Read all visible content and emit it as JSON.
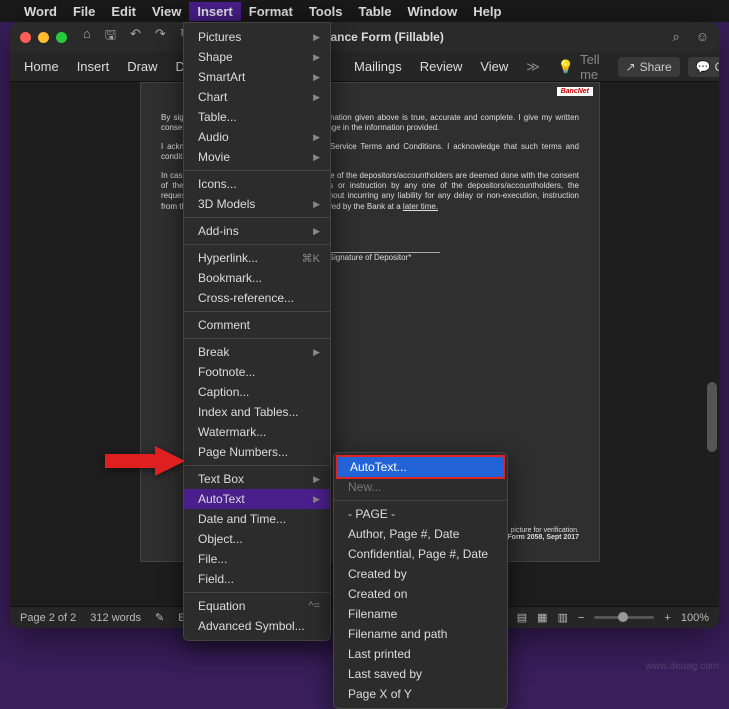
{
  "menubar": {
    "app": "Word",
    "items": [
      "File",
      "Edit",
      "View",
      "Insert",
      "Format",
      "Tools",
      "Table",
      "Window",
      "Help"
    ],
    "active_index": 3
  },
  "titlebar": {
    "title": "Maintenance Form (Fillable)"
  },
  "ribbon": {
    "tabs": [
      "Home",
      "Insert",
      "Draw",
      "Design",
      "Mailings",
      "Review",
      "View"
    ],
    "tellme": "Tell me",
    "share": "Share",
    "comments": "Comments"
  },
  "document": {
    "logo": "BancNet",
    "para1": "By signing this form, I/we certify that the information given above is true, accurate and complete. I give my written consent to and agree to inform PNB of any change in the information provided.",
    "para2": "I acknowledge receipt of the Digital Banking Service Terms and Conditions. I acknowledge that such terms and conditions apply.",
    "para3": "In case of joint accounts, instructions by any one of the depositors/accountholders are deemed done with the consent of the others. In case of conflicting requests or instruction by any one of the depositors/accountholders, the request/instruction received earlier in time, without incurring any liability for any delay or non-execution, instruction from the co-depositors/co-accountholders received by the Bank at a",
    "para3_end": "later time.",
    "sig_label": "Signature of Depositor*",
    "footer_note": "with picture for verification.",
    "footer_form": "Form 2058, Sept 2017"
  },
  "insert_menu": {
    "groups": [
      [
        {
          "label": "Pictures",
          "sub": true
        },
        {
          "label": "Shape",
          "sub": true
        },
        {
          "label": "SmartArt",
          "sub": true
        },
        {
          "label": "Chart",
          "sub": true
        },
        {
          "label": "Table...",
          "sub": false
        },
        {
          "label": "Audio",
          "sub": true
        },
        {
          "label": "Movie",
          "sub": true
        }
      ],
      [
        {
          "label": "Icons...",
          "sub": false
        },
        {
          "label": "3D Models",
          "sub": true
        }
      ],
      [
        {
          "label": "Add-ins",
          "sub": true
        }
      ],
      [
        {
          "label": "Hyperlink...",
          "sub": false,
          "shortcut": "⌘K"
        },
        {
          "label": "Bookmark...",
          "sub": false
        },
        {
          "label": "Cross-reference...",
          "sub": false
        }
      ],
      [
        {
          "label": "Comment",
          "sub": false
        }
      ],
      [
        {
          "label": "Break",
          "sub": true
        },
        {
          "label": "Footnote...",
          "sub": false
        },
        {
          "label": "Caption...",
          "sub": false
        },
        {
          "label": "Index and Tables...",
          "sub": false
        },
        {
          "label": "Watermark...",
          "sub": false
        },
        {
          "label": "Page Numbers...",
          "sub": false
        }
      ],
      [
        {
          "label": "Text Box",
          "sub": true
        },
        {
          "label": "AutoText",
          "sub": true,
          "hl": true
        },
        {
          "label": "Date and Time...",
          "sub": false
        },
        {
          "label": "Object...",
          "sub": false
        },
        {
          "label": "File...",
          "sub": false
        },
        {
          "label": "Field...",
          "sub": false
        }
      ],
      [
        {
          "label": "Equation",
          "sub": true,
          "shortcut": "^="
        },
        {
          "label": "Advanced Symbol...",
          "sub": false
        }
      ]
    ]
  },
  "autotext_submenu": {
    "top": [
      {
        "label": "AutoText...",
        "hl": true
      },
      {
        "label": "New...",
        "dim": true
      }
    ],
    "entries": [
      "- PAGE -",
      "Author, Page #, Date",
      "Confidential, Page #, Date",
      "Created by",
      "Created on",
      "Filename",
      "Filename and path",
      "Last printed",
      "Last saved by",
      "Page X of Y"
    ]
  },
  "statusbar": {
    "page": "Page 2 of 2",
    "words": "312 words",
    "lang": "English (United States)",
    "zoom": "100%"
  },
  "watermark": "www.deuag.com"
}
